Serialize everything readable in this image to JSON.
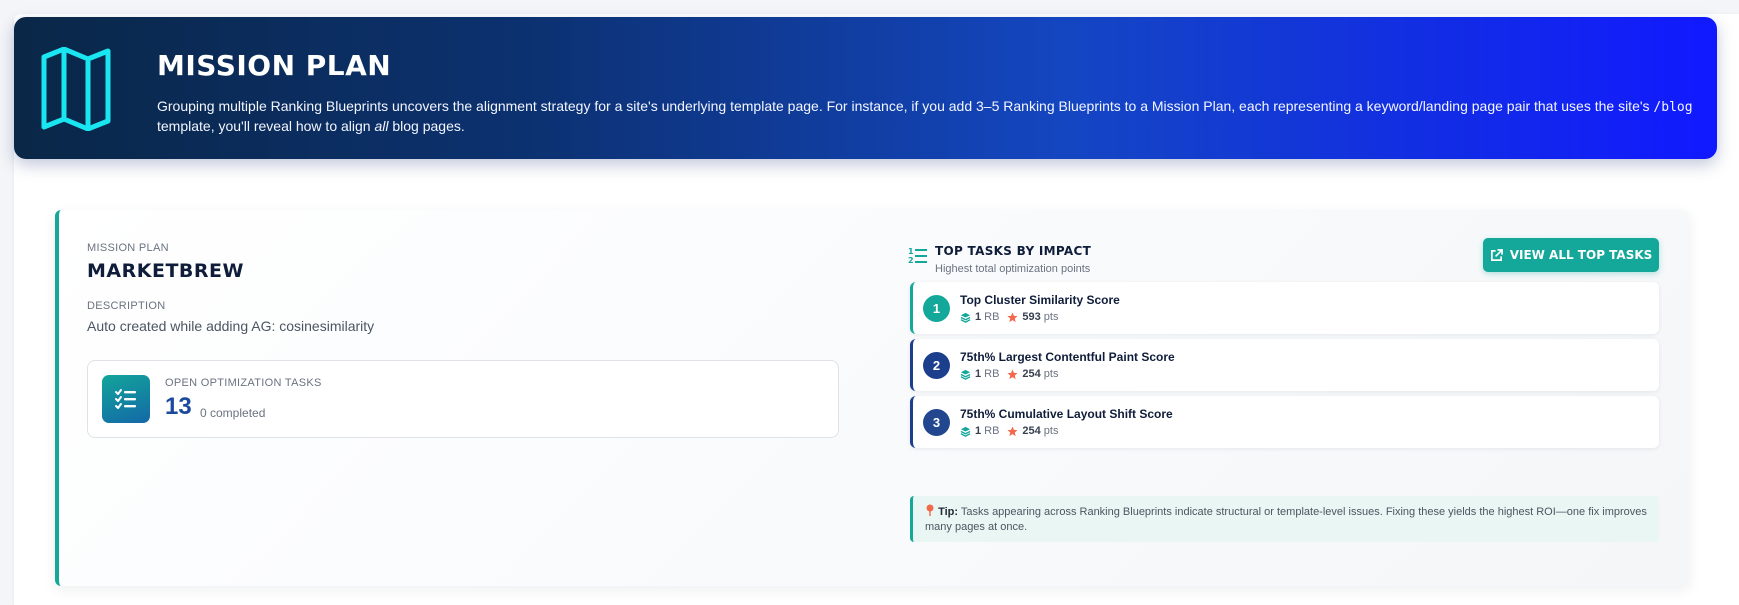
{
  "banner": {
    "title": "Mission Plan",
    "description_parts": {
      "a": "Grouping multiple Ranking Blueprints uncovers the alignment strategy for a site's underlying template page. For instance, if you add 3–5 Ranking Blueprints to a Mission Plan, each representing a keyword/landing page pair that uses the site's ",
      "code": "/blog",
      "b": " template, you'll reveal how to align ",
      "em": "all",
      "c": " blog pages."
    },
    "icon": "map-icon"
  },
  "plan": {
    "label": "Mission Plan",
    "name": "MARKETBREW",
    "description_label": "Description",
    "description": "Auto created while adding AG: cosinesimilarity"
  },
  "stats": {
    "label": "Open Optimization Tasks",
    "value": "13",
    "completed": "0 completed",
    "icon": "checklist-icon"
  },
  "top_tasks": {
    "title": "Top Tasks by Impact",
    "subtitle": "Highest total optimization points",
    "view_all_label": "View All Top Tasks",
    "items": [
      {
        "rank": "1",
        "name": "Top Cluster Similarity Score",
        "rb_count": "1",
        "rb_unit": "RB",
        "points": "593",
        "points_unit": "pts",
        "color": "#14a89a"
      },
      {
        "rank": "2",
        "name": "75th% Largest Contentful Paint Score",
        "rb_count": "1",
        "rb_unit": "RB",
        "points": "254",
        "points_unit": "pts",
        "color": "#1b3f8c"
      },
      {
        "rank": "3",
        "name": "75th% Cumulative Layout Shift Score",
        "rb_count": "1",
        "rb_unit": "RB",
        "points": "254",
        "points_unit": "pts",
        "color": "#23478f"
      }
    ],
    "tip_label": "Tip:",
    "tip_text": "Tasks appearing across Ranking Blueprints indicate structural or template-level issues. Fixing these yields the highest ROI—one fix improves many pages at once."
  },
  "colors": {
    "accent_teal": "#14a89a",
    "navy": "#1b3f8c",
    "banner_start": "#0a2747",
    "banner_end": "#1119ff",
    "star": "#f26a4b"
  }
}
